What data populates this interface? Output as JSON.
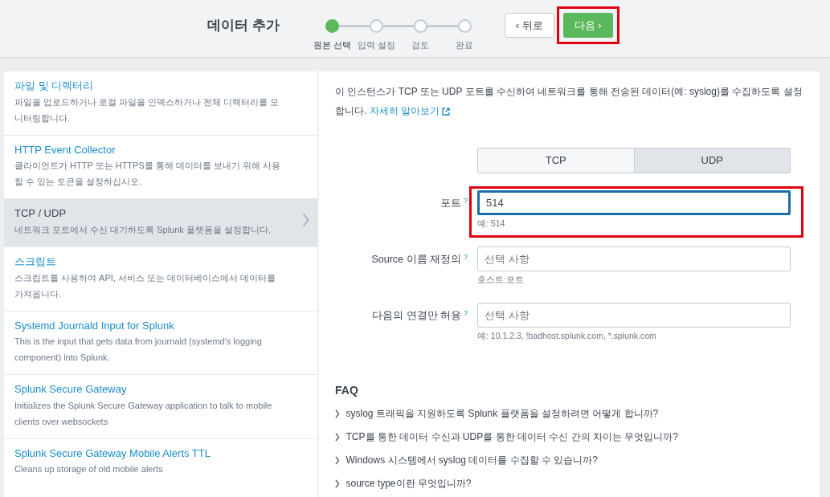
{
  "header": {
    "title": "데이터 추가",
    "steps": [
      {
        "label": "원본 선택",
        "selected": true
      },
      {
        "label": "입력 설정",
        "selected": false
      },
      {
        "label": "검토",
        "selected": false
      },
      {
        "label": "완료",
        "selected": false
      }
    ],
    "back_button": "‹ 뒤로",
    "next_button": {
      "label": "다음 ›",
      "highlighted": true
    }
  },
  "sources": [
    {
      "title": "파일 및 디렉터리",
      "description": "파일을 업로드하거나 로컬 파일을 인덱스하거나 전체 디렉터리를 모니터링합니다.",
      "selected": false
    },
    {
      "title": "HTTP Event Collector",
      "description": "클라이언트가 HTTP 또는 HTTPS를 통해 데이터를 보내기 위해 사용할 수 있는 토큰을 설정하십시오.",
      "selected": false
    },
    {
      "title": "TCP / UDP",
      "description": "네트워크 포트에서 수신 대기하도록 Splunk 플랫폼을 설정합니다.",
      "selected": true
    },
    {
      "title": "스크립트",
      "description": "스크립트를 사용하여 API, 서비스 또는 데이터베이스에서 데이터를 가져옵니다.",
      "selected": false
    },
    {
      "title": "Systemd Journald Input for Splunk",
      "description": "This is the input that gets data from journald (systemd's logging component) into Splunk.",
      "selected": false
    },
    {
      "title": "Splunk Secure Gateway",
      "description": "Initializes the Splunk Secure Gateway application to talk to mobile clients over websockets",
      "selected": false
    },
    {
      "title": "Splunk Secure Gateway Mobile Alerts TTL",
      "description": "Cleans up storage of old mobile alerts",
      "selected": false
    }
  ],
  "form": {
    "description": "이 인스턴스가 TCP 또는 UDP 포트를 수신하여 네트워크를 통해 전송된 데이터(예: syslog)를 수집하도록 설정합니다.",
    "learn_more_link": "자세히 알아보기",
    "protocol_tabs": [
      {
        "label": "TCP",
        "selected": false
      },
      {
        "label": "UDP",
        "selected": true
      }
    ],
    "fields": [
      {
        "label": "포트",
        "help_mark": "?",
        "value": "514",
        "hint": "예: 514",
        "focused": true,
        "highlighted": true
      },
      {
        "label": "Source 이름 재정의",
        "help_mark": "?",
        "placeholder": "선택 사항",
        "hint": "호스트:포트",
        "focused": false,
        "highlighted": false
      },
      {
        "label": "다음의 연결만 허용",
        "help_mark": "?",
        "placeholder": "선택 사항",
        "hint": "예: 10.1.2.3, !badhost.splunk.com, *.splunk.com",
        "focused": false,
        "highlighted": false
      }
    ]
  },
  "faq": {
    "title": "FAQ",
    "items": [
      "syslog 트래픽을 지원하도록 Splunk 플랫폼을 설정하려면 어떻게 합니까?",
      "TCP를 통한 데이터 수신과 UDP를 통한 데이터 수신 간의 차이는 무엇입니까?",
      "Windows 시스템에서 syslog 데이터를 수집할 수 있습니까?",
      "source type이란 무엇입니까?"
    ]
  }
}
